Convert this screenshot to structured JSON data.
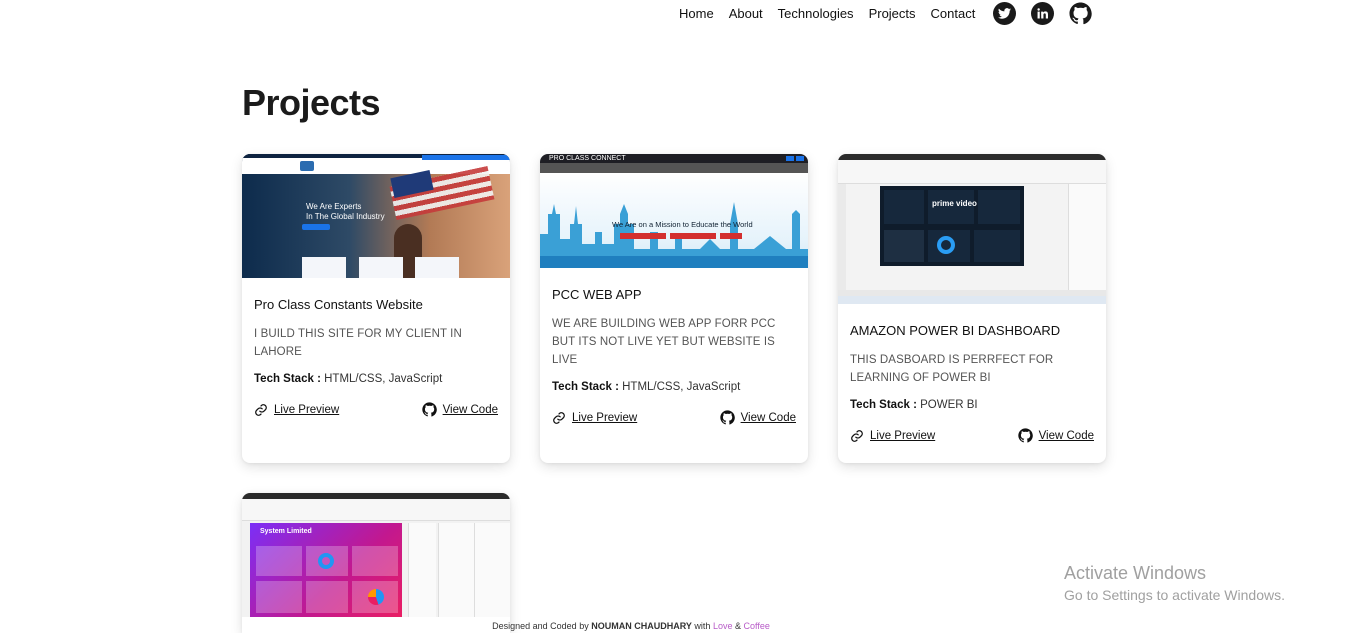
{
  "nav": {
    "links": [
      "Home",
      "About",
      "Technologies",
      "Projects",
      "Contact"
    ]
  },
  "socials": {
    "twitter": "twitter-icon",
    "linkedin": "linkedin-icon",
    "github": "github-icon"
  },
  "page_title": "Projects",
  "projects": [
    {
      "title": "Pro Class Constants Website",
      "description": "I BUILD THIS SITE FOR MY CLIENT IN LAHORE",
      "tech_label": "Tech Stack :",
      "tech_value": "HTML/CSS, JavaScript",
      "live_label": "Live Preview",
      "code_label": "View Code",
      "thumb_text_1": "We Are Experts",
      "thumb_text_2": "In The Global Industry"
    },
    {
      "title": "PCC WEB APP",
      "description": "WE ARE BUILDING WEB APP FORR PCC BUT ITS NOT LIVE YET BUT WEBSITE IS LIVE",
      "tech_label": "Tech Stack :",
      "tech_value": "HTML/CSS, JavaScript",
      "live_label": "Live Preview",
      "code_label": "View Code",
      "thumb_header": "PRO CLASS CONNECT",
      "thumb_text": "We Are on a Mission to Educate the World"
    },
    {
      "title": "AMAZON POWER BI DASHBOARD",
      "description": "THIS DASBOARD IS PERRFECT FOR LEARNING OF POWER BI",
      "tech_label": "Tech Stack :",
      "tech_value": "POWER BI",
      "live_label": "Live Preview",
      "code_label": "View Code",
      "thumb_text": "prime video"
    },
    {
      "thumb_text": "System Limited"
    }
  ],
  "footer": {
    "prefix": "Designed and Coded by",
    "name": "NOUMAN CHAUDHARY",
    "with": "with",
    "love": "Love",
    "amp": "&",
    "coffee": "Coffee"
  },
  "watermark": {
    "title": "Activate Windows",
    "subtitle": "Go to Settings to activate Windows."
  },
  "colors": {
    "accent": "#0a73d9",
    "footer_highlight": "#b85cc8"
  }
}
